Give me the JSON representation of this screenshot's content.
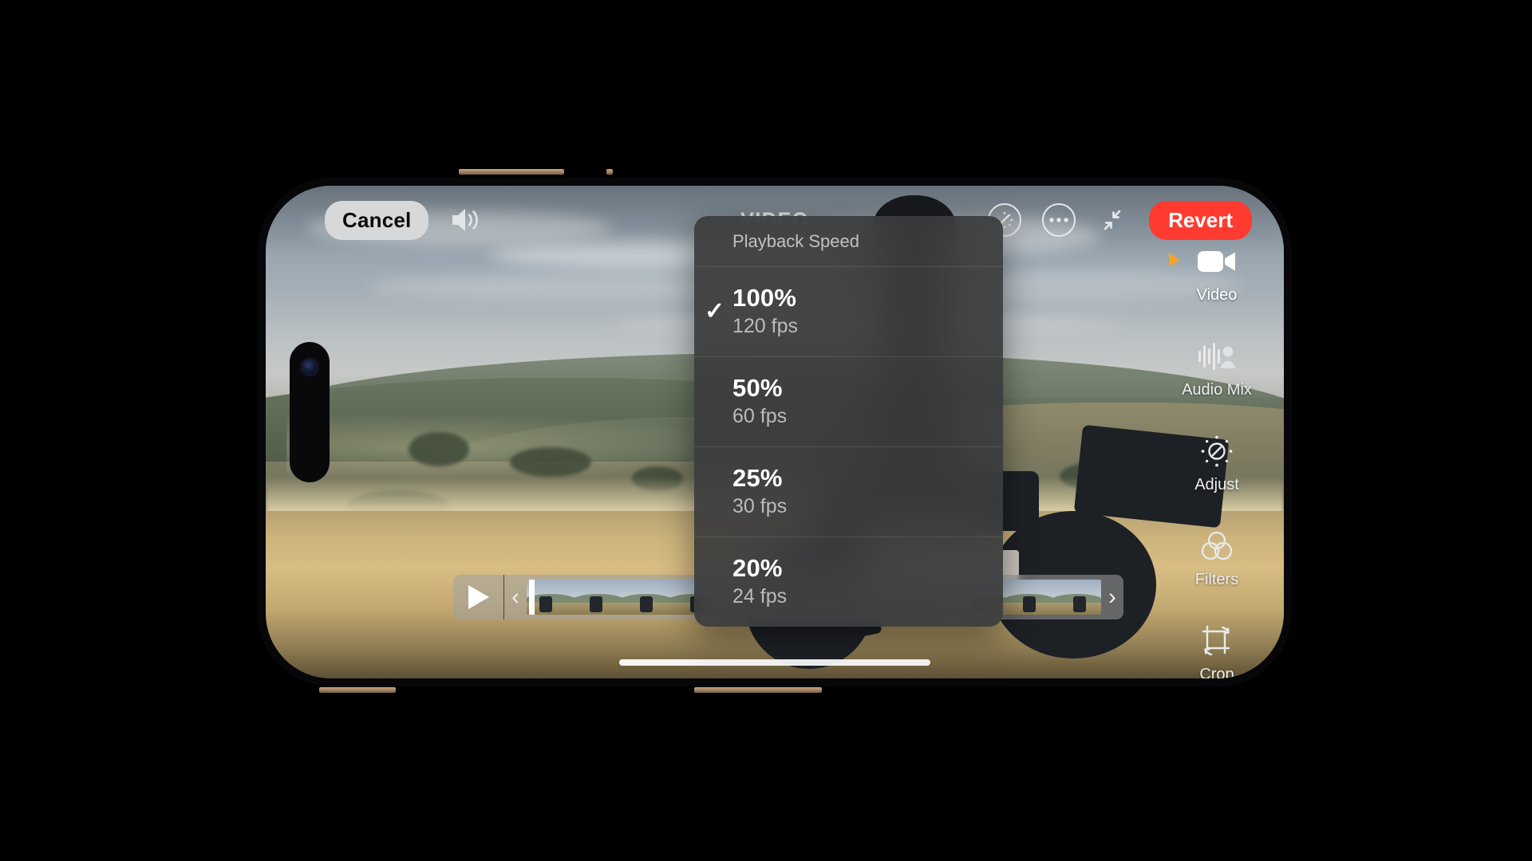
{
  "app": {
    "title": "VIDEO",
    "device": "iPhone"
  },
  "toolbar": {
    "cancel_label": "Cancel",
    "revert_label": "Revert",
    "mute_icon": "speaker-wave-icon",
    "speed_icon": "speedometer-icon",
    "more_icon": "ellipsis-circle-icon",
    "collapse_icon": "arrows-collapse-icon",
    "revert_color": "#ff3b30"
  },
  "speed_menu": {
    "header": "Playback Speed",
    "check_glyph": "✓",
    "options": [
      {
        "percent": "100%",
        "fps": "120 fps",
        "selected": true
      },
      {
        "percent": "50%",
        "fps": "60 fps",
        "selected": false
      },
      {
        "percent": "25%",
        "fps": "30 fps",
        "selected": false
      },
      {
        "percent": "20%",
        "fps": "24 fps",
        "selected": false
      }
    ]
  },
  "rail": {
    "active_indicator_color": "#f5a623",
    "items": [
      {
        "label": "Video",
        "icon": "video-camera-icon",
        "active": true
      },
      {
        "label": "Audio Mix",
        "icon": "audio-mix-icon",
        "active": false
      },
      {
        "label": "Adjust",
        "icon": "adjust-dial-icon",
        "active": false
      },
      {
        "label": "Filters",
        "icon": "filters-circles-icon",
        "active": false
      },
      {
        "label": "Crop",
        "icon": "crop-rotate-icon",
        "active": false
      }
    ]
  },
  "scrubber": {
    "play_icon": "play-triangle-icon",
    "trim_left_icon": "chevron-left-trim-handle",
    "trim_right_icon": "chevron-right-trim-handle",
    "trim_left_glyph": "‹",
    "trim_right_glyph": "›",
    "frame_count": 12
  },
  "scene": {
    "description": "Mountain bike rider on a golden grass hillside overlooking rolling green and tan hills under a cloudy sky"
  }
}
